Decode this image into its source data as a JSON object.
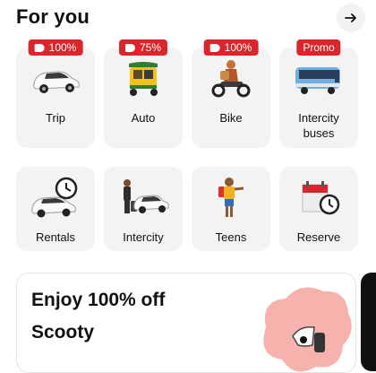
{
  "header": {
    "title": "For you"
  },
  "tiles": [
    {
      "label": "Trip",
      "badge": "100%"
    },
    {
      "label": "Auto",
      "badge": "75%"
    },
    {
      "label": "Bike",
      "badge": "100%"
    },
    {
      "label_line1": "Intercity",
      "label_line2": "buses",
      "badge": "Promo"
    },
    {
      "label": "Rentals"
    },
    {
      "label": "Intercity"
    },
    {
      "label": "Teens"
    },
    {
      "label": "Reserve"
    }
  ],
  "promo": {
    "title": "Enjoy 100% off",
    "subtitle": "Scooty"
  },
  "icons": [
    "arrow-right-icon",
    "discount-tag-icon"
  ],
  "colors": {
    "badge": "#d8262c",
    "tile_bg": "#f3f3f3",
    "promo_blob": "#f6b3ad"
  }
}
